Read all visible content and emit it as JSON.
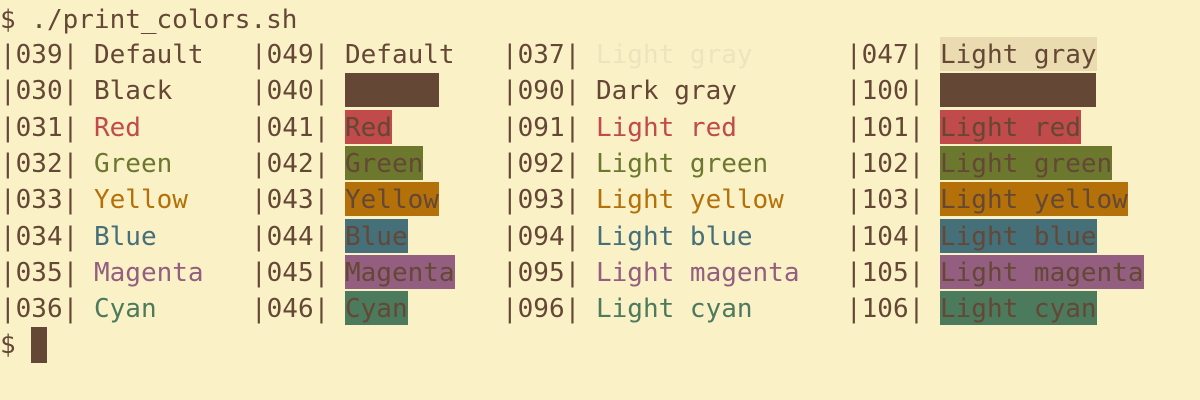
{
  "terminal": {
    "prompt_symbol": "$",
    "command_line": "$ ./print_colors.sh",
    "final_prompt": "$",
    "colors": {
      "bg": "#fbf1c7",
      "fg": "#654735",
      "black": "#654735",
      "red": "#c14a4a",
      "green": "#6c782e",
      "yellow": "#b47109",
      "blue": "#45707a",
      "magenta": "#945e80",
      "cyan": "#4c7a5d",
      "light_gray": "#eee0b7",
      "light_gray_bg": "#eadcb0"
    }
  },
  "rows": [
    {
      "c1_code": "|039|",
      "c1_text": "Default",
      "c2_code": "|049|",
      "c2_text": "Default",
      "c3_code": "|037|",
      "c3_text": "Light gray",
      "c4_code": "|047|",
      "c4_text": "Light gray"
    },
    {
      "c1_code": "|030|",
      "c1_text": "Black",
      "c2_code": "|040|",
      "c2_text": "",
      "c3_code": "|090|",
      "c3_text": "Dark gray",
      "c4_code": "|100|",
      "c4_text": ""
    },
    {
      "c1_code": "|031|",
      "c1_text": "Red",
      "c2_code": "|041|",
      "c2_text": "Red",
      "c3_code": "|091|",
      "c3_text": "Light red",
      "c4_code": "|101|",
      "c4_text": "Light red"
    },
    {
      "c1_code": "|032|",
      "c1_text": "Green",
      "c2_code": "|042|",
      "c2_text": "Green",
      "c3_code": "|092|",
      "c3_text": "Light green",
      "c4_code": "|102|",
      "c4_text": "Light green"
    },
    {
      "c1_code": "|033|",
      "c1_text": "Yellow",
      "c2_code": "|043|",
      "c2_text": "Yellow",
      "c3_code": "|093|",
      "c3_text": "Light yellow",
      "c4_code": "|103|",
      "c4_text": "Light yellow"
    },
    {
      "c1_code": "|034|",
      "c1_text": "Blue",
      "c2_code": "|044|",
      "c2_text": "Blue",
      "c3_code": "|094|",
      "c3_text": "Light blue",
      "c4_code": "|104|",
      "c4_text": "Light blue"
    },
    {
      "c1_code": "|035|",
      "c1_text": "Magenta",
      "c2_code": "|045|",
      "c2_text": "Magenta",
      "c3_code": "|095|",
      "c3_text": "Light magenta",
      "c4_code": "|105|",
      "c4_text": "Light magenta"
    },
    {
      "c1_code": "|036|",
      "c1_text": "Cyan",
      "c2_code": "|046|",
      "c2_text": "Cyan",
      "c3_code": "|096|",
      "c3_text": "Light cyan",
      "c4_code": "|106|",
      "c4_text": "Light cyan"
    }
  ]
}
